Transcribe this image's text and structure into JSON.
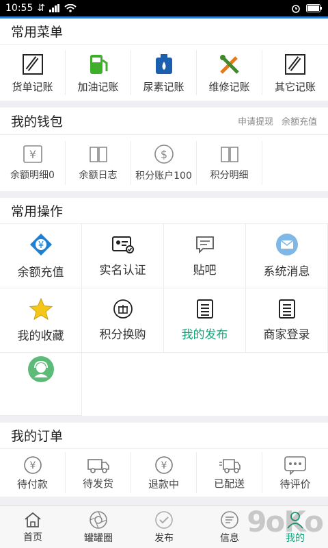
{
  "status": {
    "time": "10:55"
  },
  "menu": {
    "title": "常用菜单",
    "items": [
      {
        "label": "货单记账",
        "icon": "receipt-icon"
      },
      {
        "label": "加油记账",
        "icon": "fuel-pump-icon"
      },
      {
        "label": "尿素记账",
        "icon": "urea-can-icon"
      },
      {
        "label": "维修记账",
        "icon": "wrench-screwdriver-icon"
      },
      {
        "label": "其它记账",
        "icon": "receipt-icon"
      }
    ]
  },
  "wallet": {
    "title": "我的钱包",
    "links": [
      "申请提现",
      "余额充值"
    ],
    "items": [
      {
        "label": "余额明细0",
        "icon": "yen-ticket-icon"
      },
      {
        "label": "余额日志",
        "icon": "book-icon"
      },
      {
        "label": "积分账户100",
        "icon": "dollar-circle-icon"
      },
      {
        "label": "积分明细",
        "icon": "book-icon"
      }
    ]
  },
  "ops": {
    "title": "常用操作",
    "items": [
      {
        "label": "余额充值",
        "icon": "recharge-icon"
      },
      {
        "label": "实名认证",
        "icon": "id-card-icon"
      },
      {
        "label": "贴吧",
        "icon": "chat-bubble-icon"
      },
      {
        "label": "系统消息",
        "icon": "mail-icon"
      },
      {
        "label": "我的收藏",
        "icon": "star-icon"
      },
      {
        "label": "积分换购",
        "icon": "gift-icon"
      },
      {
        "label": "我的发布",
        "icon": "document-list-icon"
      },
      {
        "label": "商家登录",
        "icon": "document-list-icon"
      },
      {
        "label": "",
        "icon": "customer-service-icon"
      }
    ]
  },
  "orders": {
    "title": "我的订单",
    "items": [
      {
        "label": "待付款",
        "icon": "yen-refresh-icon"
      },
      {
        "label": "待发货",
        "icon": "truck-icon"
      },
      {
        "label": "退款中",
        "icon": "yen-refund-icon"
      },
      {
        "label": "已配送",
        "icon": "delivery-truck-icon"
      },
      {
        "label": "待评价",
        "icon": "comment-icon"
      }
    ]
  },
  "tabs": [
    {
      "label": "首页",
      "icon": "home-icon"
    },
    {
      "label": "罐罐圈",
      "icon": "aperture-icon"
    },
    {
      "label": "发布",
      "icon": "check-circle-icon"
    },
    {
      "label": "信息",
      "icon": "message-icon"
    },
    {
      "label": "我的",
      "icon": "user-icon"
    }
  ],
  "colors": {
    "accent": "#17a27a",
    "blue": "#2a7bd8"
  }
}
